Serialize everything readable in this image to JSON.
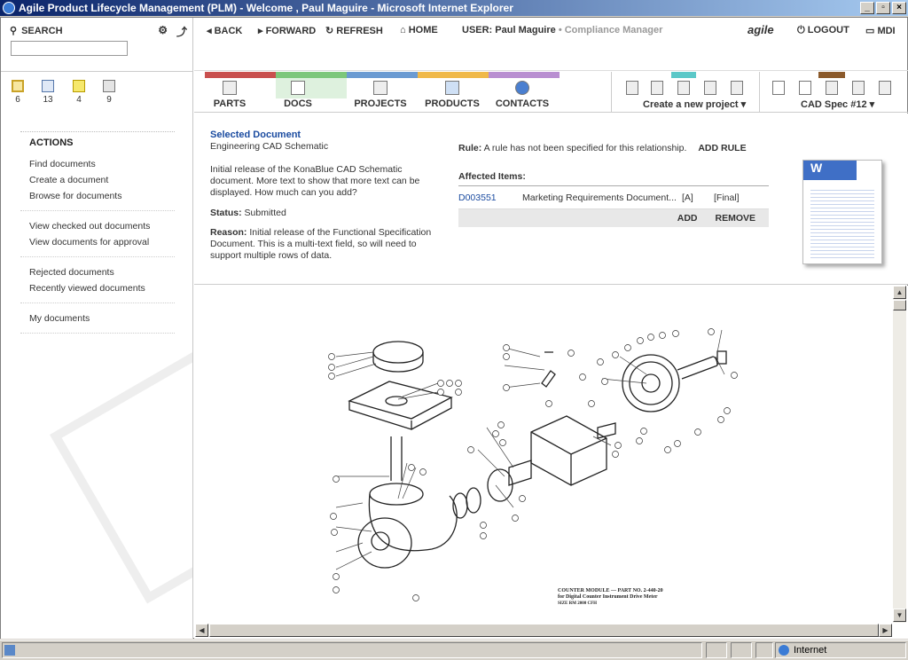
{
  "window": {
    "title": "Agile Product Lifecycle Management (PLM) - Welcome , Paul Maguire - Microsoft Internet Explorer",
    "controls": [
      "_",
      "▫",
      "×"
    ]
  },
  "sidebar": {
    "search_label": "SEARCH",
    "counts": [
      {
        "icon": "clipboard-icon",
        "value": "6"
      },
      {
        "icon": "mail-icon",
        "value": "13"
      },
      {
        "icon": "notes-icon",
        "value": "4"
      },
      {
        "icon": "badge-icon",
        "value": "9"
      }
    ],
    "actions_title": "ACTIONS",
    "groups": [
      [
        "Find documents",
        "Create a document",
        "Browse for documents"
      ],
      [
        "View checked out documents",
        "View documents for approval"
      ],
      [
        "Rejected documents",
        "Recently viewed documents"
      ],
      [
        "My documents"
      ]
    ]
  },
  "topnav": {
    "back": "BACK",
    "forward": "FORWARD",
    "refresh": "REFRESH",
    "home": "HOME",
    "user_label": "USER:",
    "user_name": "Paul Maguire",
    "user_role": "• Compliance Manager",
    "brand": "agile",
    "logout": "LOGOUT",
    "mdi": "MDI"
  },
  "modules": [
    {
      "label": "PARTS",
      "color": "#c9504f"
    },
    {
      "label": "DOCS",
      "color": "#7dc77b"
    },
    {
      "label": "PROJECTS",
      "color": "#6b9bd2"
    },
    {
      "label": "PRODUCTS",
      "color": "#f0b94a"
    },
    {
      "label": "CONTACTS",
      "color": "#b98fd1"
    }
  ],
  "project_menu": "Create a new project",
  "spec_menu": "CAD Spec #12",
  "detail": {
    "selected_label": "Selected Document",
    "name": "Engineering CAD Schematic",
    "description": "Initial release of the KonaBlue CAD Schematic document. More text to show that more text can be displayed. How much can you add?",
    "status_label": "Status:",
    "status": "Submitted",
    "reason_label": "Reason:",
    "reason": "Initial release of the Functional Specification Document. This is a multi-text field, so will need to support multiple rows of data.",
    "rule_label": "Rule:",
    "rule": "A rule has not been specified for this relationship.",
    "add_rule": "ADD RULE",
    "affected_label": "Affected Items:",
    "affected": [
      {
        "id": "D003551",
        "name": "Marketing Requirements Document...",
        "rev": "[A]",
        "state": "[Final]"
      }
    ],
    "add": "ADD",
    "remove": "REMOVE",
    "thumb_letter": "W"
  },
  "drawing": {
    "caption1": "COUNTER MODULE — PART NO. 2-440-20",
    "caption2": "for Digital Counter Instrument Drive Meter",
    "caption3": "SIZE RM 2000 CFH"
  },
  "statusbar": {
    "zone": "Internet"
  }
}
